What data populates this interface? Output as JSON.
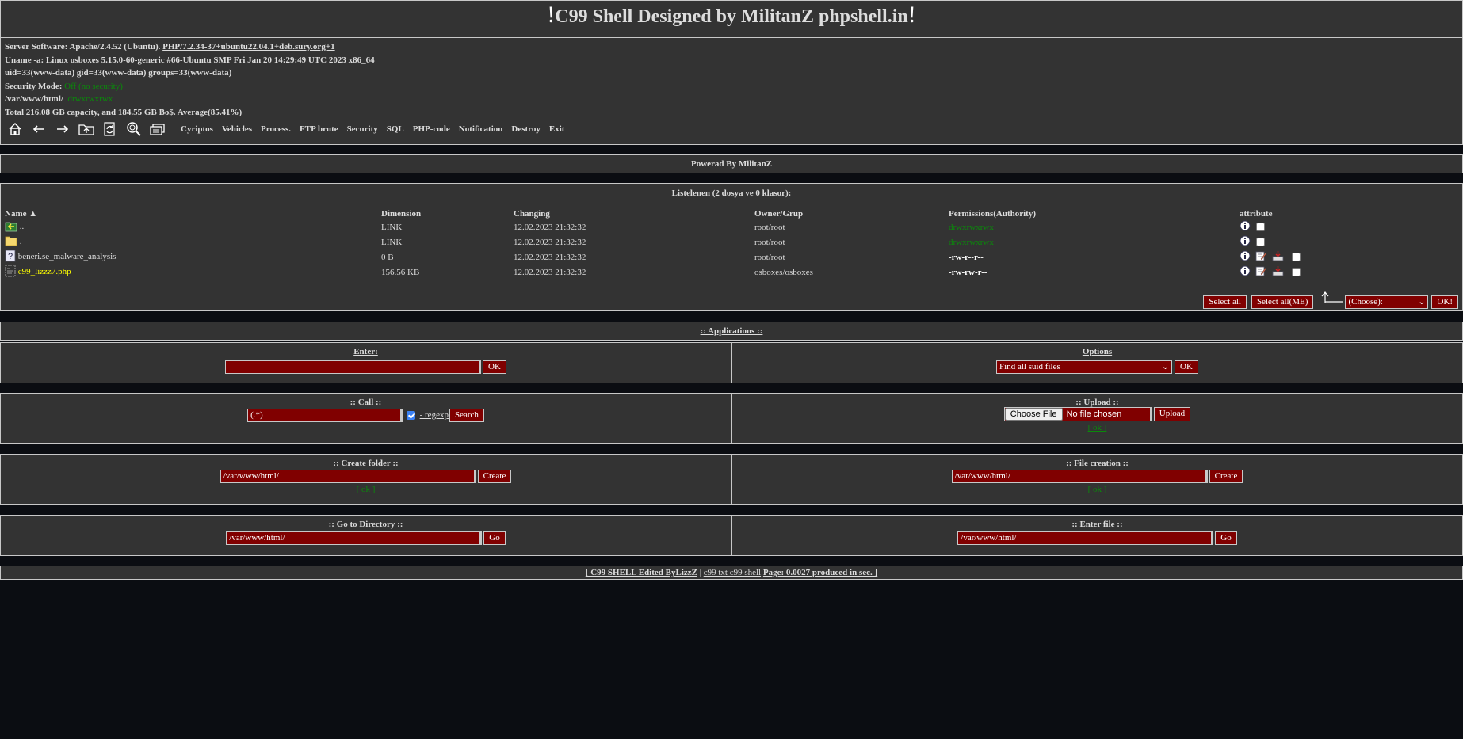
{
  "header": {
    "bang_left": "!",
    "title": "C99 Shell Designed by MilitanZ phpshell.in",
    "bang_right": "!"
  },
  "server": {
    "software_label": "Server Software:",
    "software_value": "Apache/2.4.52 (Ubuntu).",
    "php_link": "PHP/7.2.34-37+ubuntu22.04.1+deb.sury.org+1",
    "uname": "Uname -a: Linux osboxes 5.15.0-60-generic #66-Ubuntu SMP Fri Jan 20 14:29:49 UTC 2023 x86_64",
    "uid": "uid=33(www-data) gid=33(www-data) groups=33(www-data)",
    "security_label": "Security Mode:",
    "security_value": "Off (no security)",
    "path": "/var/www/html/",
    "path_perms": "drwxrwxrwx",
    "disk": "Total 216.08 GB capacity, and 184.55 GB Bo$. Average(85.41%)"
  },
  "toolbar": {
    "icons": [
      "home-icon",
      "back-arrow-icon",
      "forward-arrow-icon",
      "folder-up-icon",
      "refresh-icon",
      "search-icon",
      "buffer-icon"
    ],
    "links": [
      "Cyriptos",
      "Vehicles",
      "Process.",
      "FTP brute",
      "Security",
      "SQL",
      "PHP-code",
      "Notification",
      "Destroy",
      "Exit"
    ]
  },
  "powered": "Powerad By MilitanZ",
  "listing": {
    "caption": "Listelenen (2 dosya ve 0 klasor):",
    "columns": [
      "Name",
      "Dimension",
      "Changing",
      "Owner/Grup",
      "Permissions(Authority)",
      "attribute"
    ],
    "sort_arrow": "▲",
    "rows": [
      {
        "name": "..",
        "icon": "back-folder-icon",
        "dimension": "LINK",
        "changing": "12.02.2023 21:32:32",
        "owner": "root/root",
        "perms": "drwxrwxrwx",
        "perm_style": "green"
      },
      {
        "name": ".",
        "icon": "folder-icon",
        "dimension": "LINK",
        "changing": "12.02.2023 21:32:32",
        "owner": "root/root",
        "perms": "drwxrwxrwx",
        "perm_style": "green"
      },
      {
        "name": "beneri.se_malware_analysis",
        "icon": "unknown-file-icon",
        "dimension": "0 B",
        "changing": "12.02.2023 21:32:32",
        "owner": "root/root",
        "perms": "-rw-r--r--",
        "perm_style": "bold"
      },
      {
        "name": "c99_lizzz7.php",
        "icon": "php-file-icon",
        "dimension": "156.56 KB",
        "changing": "12.02.2023 21:32:32",
        "owner": "osboxes/osboxes",
        "perms": "-rw-rw-r--",
        "perm_style": "bold"
      }
    ],
    "select_all": "Select all",
    "select_all_me": "Select all(ME)",
    "choose": "(Choose):",
    "ok": "OK!"
  },
  "applications": {
    "title": ":: Applications ::",
    "enter_label": "Enter:",
    "enter_ok": "OK",
    "options_label": "Options",
    "options_selected": "Find all suid files",
    "options_ok": "OK"
  },
  "call": {
    "title": ":: Call ::",
    "value": "(.*)",
    "regexp": "- regexp",
    "search": "Search"
  },
  "upload": {
    "title": ":: Upload ::",
    "choose": "Choose File",
    "no_file": "No file chosen",
    "button": "Upload",
    "ok": "[ ok ]"
  },
  "create_folder": {
    "title": ":: Create folder ::",
    "value": "/var/www/html/",
    "button": "Create",
    "ok": "[ ok ]"
  },
  "file_creation": {
    "title": ":: File creation ::",
    "value": "/var/www/html/",
    "button": "Create",
    "ok": "[ ok ]"
  },
  "go_dir": {
    "title": ":: Go to Directory ::",
    "value": "/var/www/html/",
    "button": "Go"
  },
  "enter_file": {
    "title": ":: Enter file ::",
    "value": "/var/www/html/",
    "button": "Go"
  },
  "footer": {
    "brand": "[ C99 SHELL Edited ByLizzZ",
    "sep": "|",
    "middle": "c99 txt c99 shell",
    "page_label": "Page: 0.0027 produced in sec. ]"
  },
  "colors": {
    "background": "#0b0d12",
    "panel": "#333333",
    "input": "#800000",
    "green": "#0a8a0a",
    "yellow": "#ffff00"
  }
}
